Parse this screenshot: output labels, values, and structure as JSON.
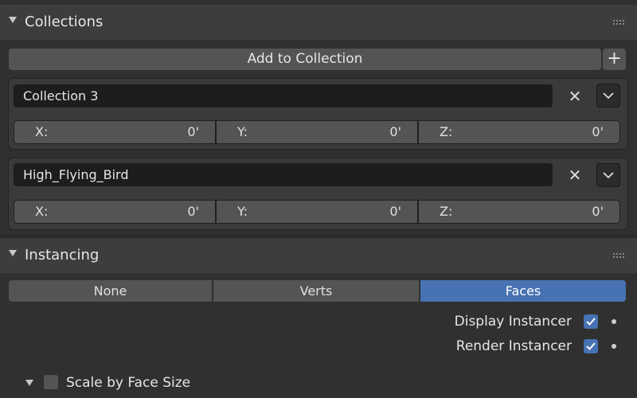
{
  "collections_panel": {
    "title": "Collections",
    "add_button_label": "Add to Collection",
    "add_plus_label": "+",
    "items": [
      {
        "name": "Collection 3",
        "offset": {
          "x_label": "X:",
          "x_value": "0'",
          "y_label": "Y:",
          "y_value": "0'",
          "z_label": "Z:",
          "z_value": "0'"
        }
      },
      {
        "name": "High_Flying_Bird",
        "offset": {
          "x_label": "X:",
          "x_value": "0'",
          "y_label": "Y:",
          "y_value": "0'",
          "z_label": "Z:",
          "z_value": "0'"
        }
      }
    ]
  },
  "instancing_panel": {
    "title": "Instancing",
    "modes": [
      "None",
      "Verts",
      "Faces"
    ],
    "active_mode": "Faces",
    "display_instancer": {
      "label": "Display Instancer",
      "checked": true
    },
    "render_instancer": {
      "label": "Render Instancer",
      "checked": true
    },
    "scale_by_face_size": {
      "label": "Scale by Face Size",
      "checked": false
    }
  },
  "icons": {
    "remove": "x-icon",
    "dropdown": "chevron-down-icon",
    "panel_toggle": "triangle-down-icon",
    "drag": "grip-icon"
  },
  "colors": {
    "accent": "#4772b3",
    "panel_header": "#3d3d3d",
    "background": "#303030",
    "button": "#545454",
    "field": "#1d1d1d"
  }
}
